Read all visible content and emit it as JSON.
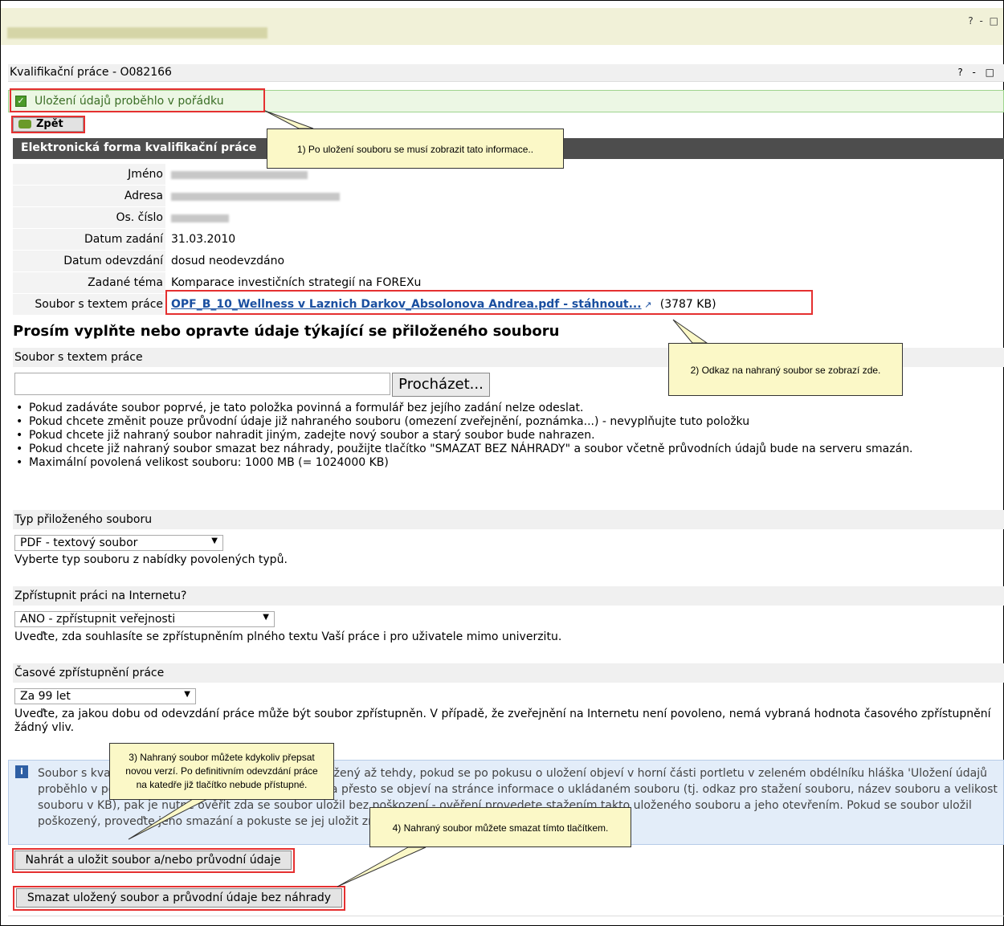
{
  "window": {
    "top_controls": "? - □",
    "portlet_controls": "? - □",
    "portlet_title": "Kvalifikační práce - O082166"
  },
  "status": {
    "success_message": "Uložení údajů proběhlo v pořádku"
  },
  "nav": {
    "back_label": "Zpět"
  },
  "section": {
    "title": "Elektronická forma kvalifikační práce"
  },
  "info": {
    "rows": [
      {
        "label": "Jméno",
        "value": ""
      },
      {
        "label": "Adresa",
        "value": ""
      },
      {
        "label": "Os. číslo",
        "value": ""
      },
      {
        "label": "Datum zadání",
        "value": "31.03.2010"
      },
      {
        "label": "Datum odevzdání",
        "value": "dosud neodevzdáno"
      },
      {
        "label": "Zadané téma",
        "value": "Komparace investičních strategií na FOREXu"
      }
    ],
    "file_label": "Soubor s textem práce",
    "file_link": "OPF_B_10_Wellness v Laznich Darkov_Absolonova Andrea.pdf - stáhnout...",
    "file_size": "(3787 KB)"
  },
  "form": {
    "heading": "Prosím vyplňte nebo opravte údaje týkající se přiloženého souboru",
    "file_section_label": "Soubor s textem práce",
    "browse_label": "Procházet...",
    "notes": [
      "Pokud zadáváte soubor poprvé, je tato položka povinná a formulář bez jejího zadání nelze odeslat.",
      "Pokud chcete změnit pouze průvodní údaje již nahraného souboru (omezení zveřejnění, poznámka...) - nevyplňujte tuto položku",
      "Pokud chcete již nahraný soubor nahradit jiným, zadejte nový soubor a starý soubor bude nahrazen.",
      "Pokud chcete již nahraný soubor smazat bez náhrady, použijte tlačítko \"SMAZAT BEZ NÁHRADY\" a soubor včetně průvodních údajů bude na serveru smazán.",
      "Maximální povolená velikost souboru: 1000 MB (= 1024000 KB)"
    ],
    "type_label": "Typ přiloženého souboru",
    "type_value": "PDF - textový soubor",
    "type_help": "Vyberte typ souboru z nabídky povolených typů.",
    "internet_label": "Zpřístupnit práci na Internetu?",
    "internet_value": "ANO - zpřístupnit veřejnosti",
    "internet_help": "Uveďte, zda souhlasíte se zpřístupněním plného textu Vaší práce i pro uživatele mimo univerzitu.",
    "time_label": "Časové zpřístupnění práce",
    "time_value": "Za 99 let",
    "time_help": "Uveďte, za jakou dobu od odevzdání práce může být soubor zpřístupněn. V případě, že zveřejnění na Internetu není povoleno, nemá vybraná hodnota časového zpřístupnění žádný vliv.",
    "info_text": "Soubor s kvalifikační prací je na serveru úspěšně uložený až tehdy, pokud se po pokusu o uložení objeví v horní části portletu v zeleném obdélníku hláška 'Uložení údajů proběhlo v pořádku'. Pokud se tato hláška nevypíše a přesto se objeví na stránce informace o ukládaném souboru (tj. odkaz pro stažení souboru, název souboru a velikost souboru v KB), pak je nutné ověřit zda se soubor uložil bez poškození - ověření provedete stažením takto uloženého souboru a jeho otevřením. Pokud se soubor uložil poškozený, proveďte jeho smazání a pokuste se jej uložit znovu.",
    "save_button": "Nahrát a uložit soubor a/nebo průvodní údaje",
    "delete_button": "Smazat uložený soubor a průvodní údaje bez náhrady"
  },
  "callouts": [
    "1) Po uložení souboru se musí zobrazit tato informace..",
    "2) Odkaz na nahraný soubor se zobrazí zde.",
    "3) Nahraný soubor můžete kdykoliv přepsat novou verzí. Po definitivním odevzdání práce na katedře již tlačítko nebude přístupné.",
    "4) Nahraný soubor můžete smazat tímto tlačítkem."
  ],
  "colors": {
    "success_bg": "#ecf7e4",
    "annotation_red": "#e53030",
    "callout_bg": "#fbf8c7",
    "section_header": "#4d4d4d",
    "link": "#1a4fa0"
  }
}
